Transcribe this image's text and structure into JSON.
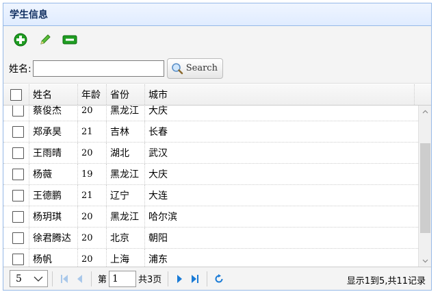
{
  "panel": {
    "title": "学生信息"
  },
  "toolbar": {
    "add_icon": "plus-icon",
    "edit_icon": "pencil-icon",
    "remove_icon": "minus-icon",
    "colors": {
      "add": "#1f9d22",
      "edit": "#4aa632",
      "remove": "#1f9d22"
    }
  },
  "search": {
    "label": "姓名:",
    "value": "",
    "placeholder": "",
    "button_label": "Search"
  },
  "grid": {
    "columns": [
      "姓名",
      "年龄",
      "省份",
      "城市"
    ],
    "rows": [
      {
        "name": "蔡俊杰",
        "age": "20",
        "province": "黑龙江",
        "city": "大庆"
      },
      {
        "name": "郑承昊",
        "age": "21",
        "province": "吉林",
        "city": "长春"
      },
      {
        "name": "王雨晴",
        "age": "20",
        "province": "湖北",
        "city": "武汉"
      },
      {
        "name": "杨薇",
        "age": "19",
        "province": "黑龙江",
        "city": "大庆"
      },
      {
        "name": "王德鹏",
        "age": "21",
        "province": "辽宁",
        "city": "大连"
      },
      {
        "name": "杨玥琪",
        "age": "20",
        "province": "黑龙江",
        "city": "哈尔滨"
      },
      {
        "name": "徐君腾达",
        "age": "20",
        "province": "北京",
        "city": "朝阳"
      },
      {
        "name": "杨帆",
        "age": "20",
        "province": "上海",
        "city": "浦东"
      }
    ]
  },
  "pager": {
    "page_size": "5",
    "page_prefix": "第",
    "current_page": "1",
    "page_total": "共3页",
    "info": "显示1到5,共11记录",
    "accent": "#1a7bd6"
  }
}
